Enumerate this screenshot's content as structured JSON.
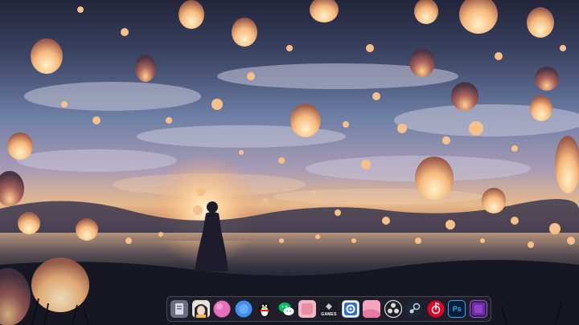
{
  "desktop": {
    "wallpaper": "lantern-night-sky-wallpaper"
  },
  "dock": {
    "items": [
      {
        "name": "file-manager",
        "icon": "file-manager-icon",
        "label": ""
      },
      {
        "name": "anime-character-app",
        "icon": "character-portrait-icon",
        "label": ""
      },
      {
        "name": "pink-circle-app",
        "icon": "pink-orb-icon",
        "label": ""
      },
      {
        "name": "blue-app",
        "icon": "blue-app-icon",
        "label": ""
      },
      {
        "name": "qq",
        "icon": "penguin-icon",
        "label": ""
      },
      {
        "name": "wechat",
        "icon": "wechat-icon",
        "label": ""
      },
      {
        "name": "blurred-pink-app",
        "icon": "blurred-app-icon",
        "label": ""
      },
      {
        "name": "games",
        "icon": "games-icon",
        "label": "GAMES"
      },
      {
        "name": "settings",
        "icon": "gear-icon",
        "label": ""
      },
      {
        "name": "pink-app",
        "icon": "pink-square-icon",
        "label": ""
      },
      {
        "name": "obs-studio",
        "icon": "obs-icon",
        "label": ""
      },
      {
        "name": "steam",
        "icon": "steam-icon",
        "label": ""
      },
      {
        "name": "netease-music",
        "icon": "netease-music-icon",
        "label": ""
      },
      {
        "name": "photoshop",
        "icon": "photoshop-icon",
        "label": "Ps"
      },
      {
        "name": "purple-app",
        "icon": "purple-square-icon",
        "label": ""
      }
    ]
  },
  "colors": {
    "lantern": "#f2b77a",
    "dock_bg": "#28263a",
    "qq_bg": "#1d9bf0",
    "wechat": "#07c160",
    "steam_bg": "#1b2838",
    "netease": "#e60026",
    "ps_bg": "#001e36",
    "ps_text": "#31a8ff"
  }
}
